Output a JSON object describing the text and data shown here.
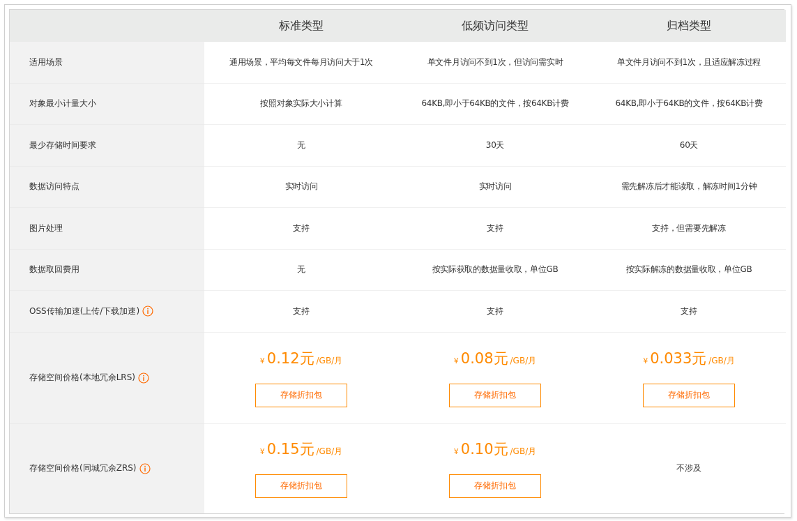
{
  "table": {
    "columns": [
      "标准类型",
      "低频访问类型",
      "归档类型"
    ],
    "rows": [
      {
        "label": "适用场景",
        "info": false,
        "cells": [
          {
            "kind": "text",
            "text": "通用场景，平均每文件每月访问大于1次"
          },
          {
            "kind": "text",
            "text": "单文件月访问不到1次，但访问需实时"
          },
          {
            "kind": "text",
            "text": "单文件月访问不到1次，且适应解冻过程"
          }
        ]
      },
      {
        "label": "对象最小计量大小",
        "info": false,
        "cells": [
          {
            "kind": "text",
            "text": "按照对象实际大小计算"
          },
          {
            "kind": "text",
            "text": "64KB,即小于64KB的文件，按64KB计费"
          },
          {
            "kind": "text",
            "text": "64KB,即小于64KB的文件，按64KB计费"
          }
        ]
      },
      {
        "label": "最少存储时间要求",
        "info": false,
        "cells": [
          {
            "kind": "text",
            "text": "无"
          },
          {
            "kind": "text",
            "text": "30天"
          },
          {
            "kind": "text",
            "text": "60天"
          }
        ]
      },
      {
        "label": "数据访问特点",
        "info": false,
        "cells": [
          {
            "kind": "text",
            "text": "实时访问"
          },
          {
            "kind": "text",
            "text": "实时访问"
          },
          {
            "kind": "text",
            "text": "需先解冻后才能读取，解冻时间1分钟"
          }
        ]
      },
      {
        "label": "图片处理",
        "info": false,
        "cells": [
          {
            "kind": "text",
            "text": "支持"
          },
          {
            "kind": "text",
            "text": "支持"
          },
          {
            "kind": "text",
            "text": "支持，但需要先解冻"
          }
        ]
      },
      {
        "label": "数据取回费用",
        "info": false,
        "cells": [
          {
            "kind": "text",
            "text": "无"
          },
          {
            "kind": "text",
            "text": "按实际获取的数据量收取，单位GB"
          },
          {
            "kind": "text",
            "text": "按实际解冻的数据量收取，单位GB"
          }
        ]
      },
      {
        "label": "OSS传输加速(上传/下载加速)",
        "info": true,
        "cells": [
          {
            "kind": "text",
            "text": "支持"
          },
          {
            "kind": "text",
            "text": "支持"
          },
          {
            "kind": "text",
            "text": "支持"
          }
        ]
      },
      {
        "label": "存储空间价格(本地冗余LRS)",
        "info": true,
        "cells": [
          {
            "kind": "price",
            "currency": "¥",
            "amount": "0.12元",
            "unit": "/GB/月",
            "button": "存储折扣包"
          },
          {
            "kind": "price",
            "currency": "¥",
            "amount": "0.08元",
            "unit": "/GB/月",
            "button": "存储折扣包"
          },
          {
            "kind": "price",
            "currency": "¥",
            "amount": "0.033元",
            "unit": "/GB/月",
            "button": "存储折扣包"
          }
        ]
      },
      {
        "label": "存储空间价格(同城冗余ZRS)",
        "info": true,
        "cells": [
          {
            "kind": "price",
            "currency": "¥",
            "amount": "0.15元",
            "unit": "/GB/月",
            "button": "存储折扣包"
          },
          {
            "kind": "price",
            "currency": "¥",
            "amount": "0.10元",
            "unit": "/GB/月",
            "button": "存储折扣包"
          },
          {
            "kind": "text",
            "text": "不涉及"
          }
        ]
      }
    ]
  }
}
